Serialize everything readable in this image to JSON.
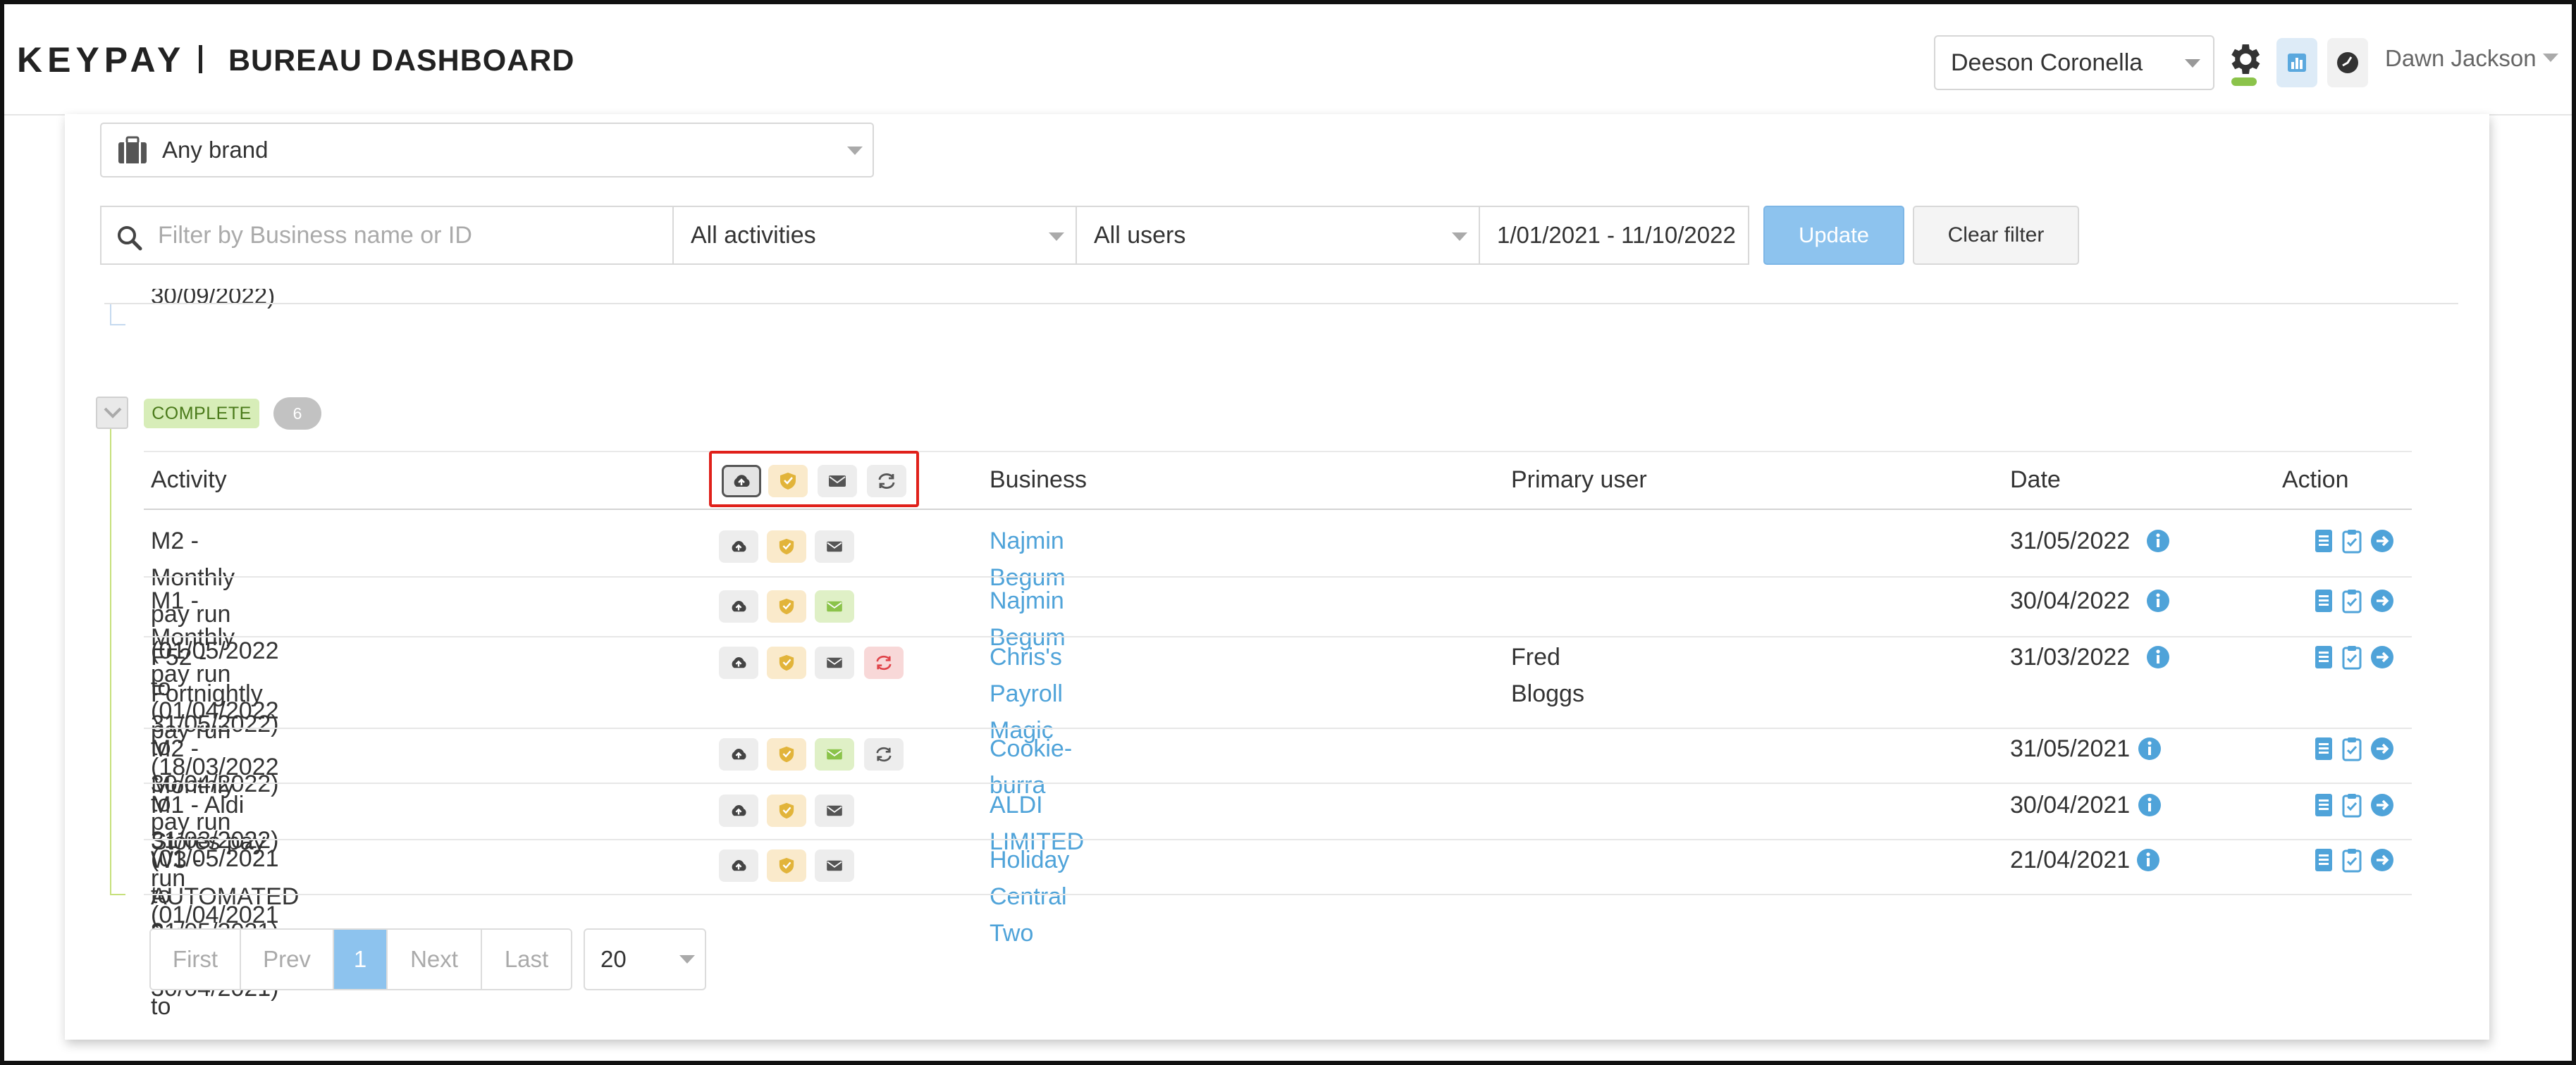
{
  "header": {
    "logo": "KEYPAY",
    "app_title": "BUREAU DASHBOARD",
    "account_select": "Deeson Coronella",
    "user_name": "Dawn Jackson"
  },
  "filters": {
    "brand": "Any brand",
    "search_placeholder": "Filter by Business name or ID",
    "activities": "All activities",
    "users": "All users",
    "date_range": "1/01/2021 - 11/10/2022",
    "update_label": "Update",
    "clear_label": "Clear filter"
  },
  "previous_section": {
    "partial_date": "30/09/2022)"
  },
  "section": {
    "status": "COMPLETE",
    "count": "6"
  },
  "table": {
    "headers": {
      "activity": "Activity",
      "business": "Business",
      "primary_user": "Primary user",
      "date": "Date",
      "action": "Action"
    },
    "rows": [
      {
        "activity_lines": [
          "M2 - Monthly pay run (01/05/2022 to 31/05/2022)",
          ""
        ],
        "business": "Najmin Begum",
        "primary_user": "",
        "date": "31/05/2022",
        "email_status": "grey",
        "sync_status": "none"
      },
      {
        "activity_lines": [
          "M1 - Monthly pay run (01/04/2022 to 30/04/2022)",
          ""
        ],
        "business": "Najmin Begum",
        "primary_user": "",
        "date": "30/04/2022",
        "email_status": "green",
        "sync_status": "none"
      },
      {
        "activity_lines": [
          "F52 - Fortnightly pay run (18/03/2022 to",
          "31/03/2022)"
        ],
        "business": "Chris's Payroll Magic",
        "primary_user": "Fred Bloggs",
        "date": "31/03/2022",
        "email_status": "grey",
        "sync_status": "red"
      },
      {
        "activity_lines": [
          "M2 - Monthly pay run (01/05/2021 to 31/05/2021)",
          ""
        ],
        "business": "Cookie-burra",
        "primary_user": "",
        "date": "31/05/2021",
        "email_status": "green",
        "sync_status": "grey"
      },
      {
        "activity_lines": [
          "M1 - Aldi Stores pay run (01/04/2021 to 30/04/2021)",
          ""
        ],
        "business": "ALDI LIMITED",
        "primary_user": "",
        "date": "30/04/2021",
        "email_status": "grey",
        "sync_status": "none"
      },
      {
        "activity_lines": [
          "W3 - AUTOMATED 2 pay run (23/04/2021 to",
          ""
        ],
        "business": "Holiday Central Two",
        "primary_user": "",
        "date": "21/04/2021",
        "email_status": "grey",
        "sync_status": "none"
      }
    ]
  },
  "pagination": {
    "first": "First",
    "prev": "Prev",
    "current": "1",
    "next": "Next",
    "last": "Last",
    "page_size": "20"
  },
  "colors": {
    "accent": "#8dc3ee",
    "link": "#4fa3d9",
    "complete_badge": "#d7edb8",
    "highlight": "#e0201a"
  }
}
